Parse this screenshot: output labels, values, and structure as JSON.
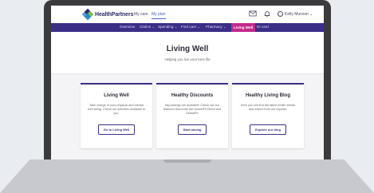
{
  "header": {
    "brand": "HealthPartners",
    "links": [
      "My care",
      "My plan"
    ],
    "active_link": "My plan",
    "user_name": "Kelly Munson",
    "icons": [
      "mail-icon",
      "bell-icon",
      "user-icon",
      "chevron-down-icon"
    ]
  },
  "nav": {
    "items": [
      "Overview",
      "Claims ⌄",
      "Spending ⌄",
      "Find care ⌄",
      "Pharmacy ⌄",
      "Living Well",
      "ID card"
    ],
    "active": "Living Well"
  },
  "hero": {
    "title": "Living Well",
    "subtitle": "Helping you live your best life"
  },
  "cards": [
    {
      "title": "Living Well",
      "text": "Take charge of your physical and mental well-being. Check out activities available to you.",
      "button": "Go to Living Well"
    },
    {
      "title": "Healthy Discounts",
      "text": "Big savings are available! Check out our featured discounts like ActivelFit Direct and GlobalFit.",
      "button": "Start saving"
    },
    {
      "title": "Healthy Living Blog",
      "text": "Here you will find the latest health trends and advice from our experts.",
      "button": "Explore our blog"
    }
  ],
  "colors": {
    "brand_purple": "#3a2e87",
    "active_pink": "#c2298c",
    "link_blue": "#3f67c6"
  }
}
